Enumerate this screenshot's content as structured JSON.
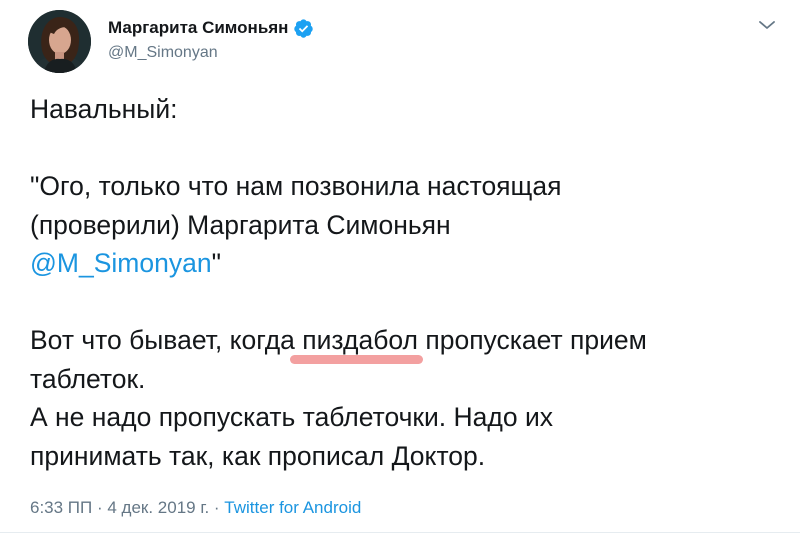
{
  "author": {
    "name": "Маргарита Симоньян",
    "handle": "@M_Simonyan",
    "verified_color": "#1da1f2"
  },
  "menu": {
    "icon": "chevron-down-icon"
  },
  "tweet": {
    "line1": "Навальный:",
    "line2": "\"Ого, только что нам позвонила настоящая",
    "line3": "(проверили) Маргарита Симоньян",
    "line4_mention": "@M_Simonyan",
    "line4_suffix": "\"",
    "line5_before": "Вот что бывает, когда ",
    "line5_highlight": "пиздабол",
    "line5_after": " пропускает прием",
    "line6": "таблеток.",
    "line7": "А не надо пропускать таблеточки. Надо их",
    "line8": "принимать так, как прописал Доктор."
  },
  "meta": {
    "time": "6:33 ПП",
    "dot1": " · ",
    "date": "4 дек. 2019 г.",
    "dot2": " · ",
    "source": "Twitter for Android"
  },
  "colors": {
    "text": "#14171a",
    "secondary": "#657786",
    "link": "#1b95e0",
    "highlight_mark": "#f3a0a0"
  }
}
